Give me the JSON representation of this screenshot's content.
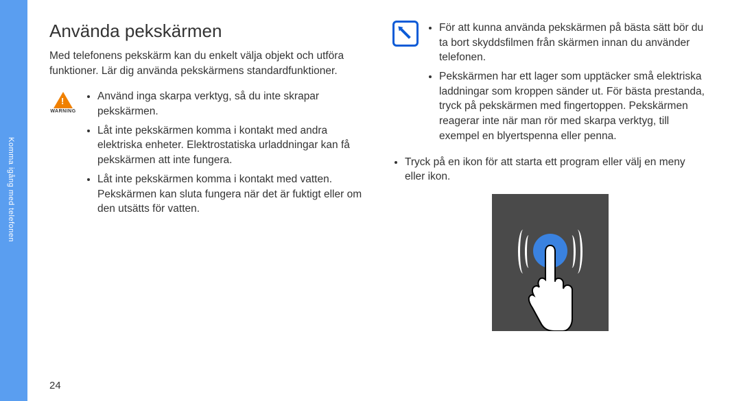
{
  "sidebar": {
    "section_label": "Komma igång med telefonen"
  },
  "page": {
    "number": "24",
    "title": "Använda pekskärmen",
    "intro": "Med telefonens pekskärm kan du enkelt välja objekt och utföra funktioner. Lär dig använda pekskärmens standardfunktioner.",
    "warning_label": "WARNING",
    "warnings": [
      "Använd inga skarpa verktyg, så du inte skrapar pekskärmen.",
      "Låt inte pekskärmen komma i kontakt med andra elektriska enheter. Elektrostatiska urladdningar kan få pekskärmen att inte fungera.",
      "Låt inte pekskärmen komma i kontakt med vatten. Pekskärmen kan sluta fungera när det är fuktigt eller om den utsätts för vatten."
    ],
    "notes": [
      "För att kunna använda pekskärmen på bästa sätt bör du ta bort skyddsfilmen från skärmen innan du använder telefonen.",
      "Pekskärmen har ett lager som upptäcker små elektriska laddningar som kroppen sänder ut. För bästa prestanda, tryck på pekskärmen med fingertoppen. Pekskärmen reagerar inte när man rör med skarpa verktyg, till exempel en blyertspenna eller penna."
    ],
    "tap_instruction": "Tryck på en ikon för att starta ett program eller välj en meny eller ikon."
  }
}
